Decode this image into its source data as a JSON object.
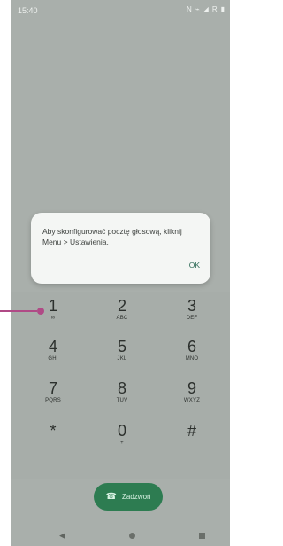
{
  "status_bar": {
    "time": "15:40",
    "icons": [
      "N",
      "wifi-icon",
      "signal-icon",
      "R",
      "battery-icon"
    ]
  },
  "dialog": {
    "message": "Aby skonfigurować pocztę głosową, kliknij Menu > Ustawienia.",
    "ok_label": "OK"
  },
  "keypad": {
    "keys": [
      {
        "digit": "1",
        "letters": "∞"
      },
      {
        "digit": "2",
        "letters": "ABC"
      },
      {
        "digit": "3",
        "letters": "DEF"
      },
      {
        "digit": "4",
        "letters": "GHI"
      },
      {
        "digit": "5",
        "letters": "JKL"
      },
      {
        "digit": "6",
        "letters": "MNO"
      },
      {
        "digit": "7",
        "letters": "PQRS"
      },
      {
        "digit": "8",
        "letters": "TUV"
      },
      {
        "digit": "9",
        "letters": "WXYZ"
      },
      {
        "digit": "*",
        "letters": ""
      },
      {
        "digit": "0",
        "letters": "+"
      },
      {
        "digit": "#",
        "letters": ""
      }
    ]
  },
  "call_button": {
    "label": "Zadzwoń"
  },
  "navigation": {
    "back_icon": "◀",
    "home_icon": "●",
    "recent_icon": "■"
  },
  "colors": {
    "background": "#a9afab",
    "dialog": "#f4f6f4",
    "call_button": "#2d7c51",
    "pointer": "#b04a86"
  }
}
